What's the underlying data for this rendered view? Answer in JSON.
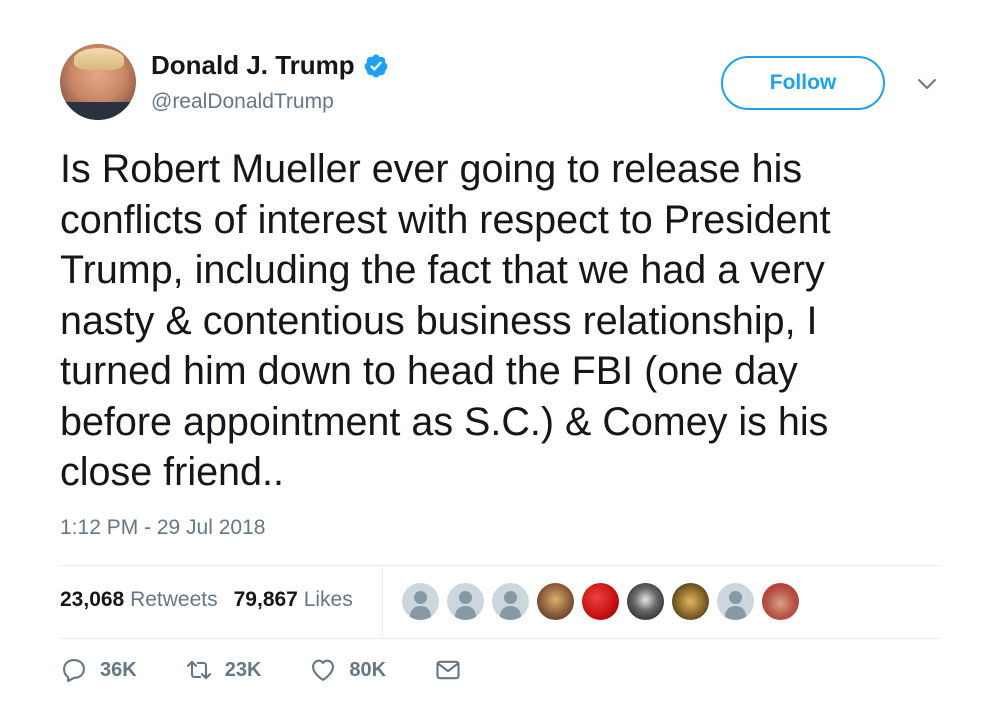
{
  "user": {
    "name": "Donald J. Trump",
    "handle": "@realDonaldTrump",
    "verified": true
  },
  "follow_label": "Follow",
  "tweet": {
    "text": "Is Robert Mueller ever going to release his\nconflicts of interest with respect to President\nTrump, including the fact that we had a very\nnasty & contentious business relationship, I\nturned him down to head the FBI (one day\nbefore appointment as S.C.) & Comey is his\nclose friend..",
    "timestamp": "1:12 PM - 29 Jul 2018"
  },
  "stats": {
    "retweets_count": "23,068",
    "retweets_label": "Retweets",
    "likes_count": "79,867",
    "likes_label": "Likes"
  },
  "actions": {
    "reply_count": "36K",
    "retweet_count": "23K",
    "like_count": "80K"
  },
  "colors": {
    "accent": "#1da1f2",
    "muted": "#657786",
    "text": "#14171a"
  }
}
